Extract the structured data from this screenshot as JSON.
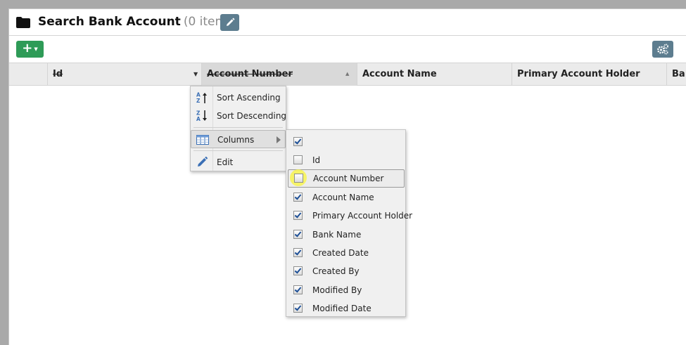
{
  "header": {
    "title": "Search Bank Account",
    "count": "(0 item)",
    "folder_icon": "folder-icon",
    "edit_icon": "pencil-icon"
  },
  "toolbar": {
    "add_label": "+",
    "add_icon": "plus-icon",
    "settings_icon": "gears-icon"
  },
  "grid": {
    "columns": [
      "Id",
      "Account Number",
      "Account Name",
      "Primary Account Holder",
      "Ba"
    ],
    "rows": []
  },
  "column_menu": {
    "items": [
      {
        "label": "Sort Ascending",
        "icon": "sort-ascending-icon"
      },
      {
        "label": "Sort Descending",
        "icon": "sort-descending-icon"
      },
      {
        "label": "Columns",
        "icon": "columns-icon"
      },
      {
        "label": "Edit",
        "icon": "pencil-icon"
      }
    ]
  },
  "columns_submenu": {
    "items": [
      {
        "label": "",
        "checked": true
      },
      {
        "label": "Id",
        "checked": false
      },
      {
        "label": "Account Number",
        "checked": false
      },
      {
        "label": "Account Name",
        "checked": true
      },
      {
        "label": "Primary Account Holder",
        "checked": true
      },
      {
        "label": "Bank Name",
        "checked": true
      },
      {
        "label": "Created Date",
        "checked": true
      },
      {
        "label": "Created By",
        "checked": true
      },
      {
        "label": "Modified By",
        "checked": true
      },
      {
        "label": "Modified Date",
        "checked": true
      }
    ]
  },
  "colors": {
    "add_button": "#2e9b57",
    "secondary_button": "#5d7d8f",
    "checkbox_tick": "#1d4f96",
    "cursor_highlight": "#faf53c"
  }
}
